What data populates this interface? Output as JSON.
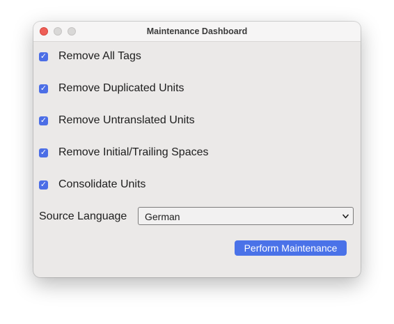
{
  "window": {
    "title": "Maintenance Dashboard"
  },
  "options": [
    {
      "label": "Remove All Tags",
      "checked": true
    },
    {
      "label": "Remove Duplicated Units",
      "checked": true
    },
    {
      "label": "Remove Untranslated Units",
      "checked": true
    },
    {
      "label": "Remove Initial/Trailing Spaces",
      "checked": true
    },
    {
      "label": "Consolidate Units",
      "checked": true
    }
  ],
  "source_language": {
    "label": "Source Language",
    "selected": "German"
  },
  "actions": {
    "perform_label": "Perform Maintenance"
  },
  "icons": {
    "checkbox_mark": "checkmark-icon",
    "dropdown": "chevron-down-icon"
  },
  "colors": {
    "accent": "#4a72e8",
    "close_button": "#ee5f57",
    "window_bg": "#ebe9e8"
  }
}
